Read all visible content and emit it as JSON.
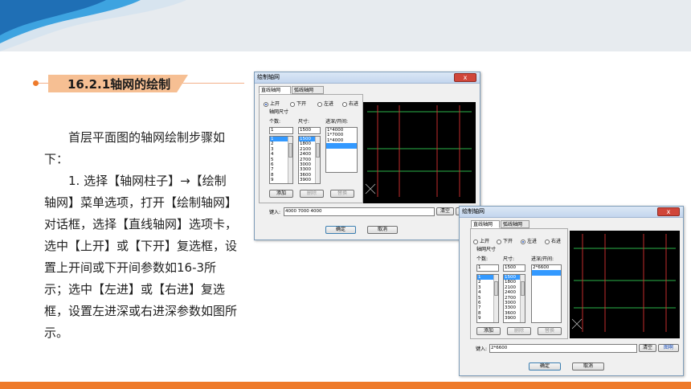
{
  "slide": {
    "section_title": "16.2.1轴网的绘制",
    "paragraphs": [
      "首层平面图的轴网绘制步骤如下：",
      "1. 选择【轴网柱子】→【绘制轴网】菜单选项，打开【绘制轴网】对话框，选择【直线轴网】选项卡，选中【上开】或【下开】复选框，设置上开间或下开间参数如16-3所示；选中【左进】或【右进】复选框，设置左进深或右进深参数如图所示。"
    ],
    "colors": {
      "accent": "#ee7a2b",
      "wave_dark": "#1f6fb5",
      "wave_light": "#3da3e0",
      "header_bg": "#e7ebef"
    }
  },
  "dialog1": {
    "title": "绘制轴网",
    "close_label": "x",
    "tabs": [
      "直线轴网",
      "弧线轴网"
    ],
    "radios": [
      "上开",
      "下开",
      "左进",
      "右进"
    ],
    "selected_radio": "上开",
    "group_label": "轴网尺寸",
    "count_label": "个数:",
    "size_label": "尺寸:",
    "span_label": "进深/开间:",
    "count_value": "1",
    "size_value": "1500",
    "count_list": [
      "1",
      "2",
      "3",
      "4",
      "5",
      "6",
      "7",
      "8",
      "9"
    ],
    "size_list": [
      "1500",
      "1800",
      "2100",
      "2400",
      "2700",
      "3000",
      "3300",
      "3600",
      "3900"
    ],
    "span_list": [
      "1*4000",
      "1*7000",
      "1*4000",
      ""
    ],
    "add_button": "添加",
    "delete_button": "删除",
    "replace_button": "替换",
    "input_label": "键入:",
    "input_value": "4000 7000 4000",
    "clear_button": "清空",
    "pick_button": "图啊",
    "ok_button": "确定",
    "cancel_button": "取消"
  },
  "dialog2": {
    "title": "绘制轴网",
    "close_label": "x",
    "tabs": [
      "直线轴网",
      "弧线轴网"
    ],
    "radios": [
      "上开",
      "下开",
      "左进",
      "右进"
    ],
    "selected_radio": "左进",
    "group_label": "轴网尺寸",
    "count_label": "个数:",
    "size_label": "尺寸:",
    "span_label": "进深/开间:",
    "count_value": "1",
    "size_value": "1500",
    "span_value": "2*6600",
    "count_list": [
      "1",
      "2",
      "3",
      "4",
      "5",
      "6",
      "7",
      "8",
      "9"
    ],
    "size_list": [
      "1500",
      "1800",
      "2100",
      "2400",
      "2700",
      "3000",
      "3300",
      "3600",
      "3900"
    ],
    "span_list": [
      "2*6600",
      ""
    ],
    "add_button": "添加",
    "delete_button": "删除",
    "replace_button": "替换",
    "input_label": "键入:",
    "input_value": "2*6600",
    "clear_button": "清空",
    "pick_button": "图啊",
    "ok_button": "确定",
    "cancel_button": "取消"
  }
}
